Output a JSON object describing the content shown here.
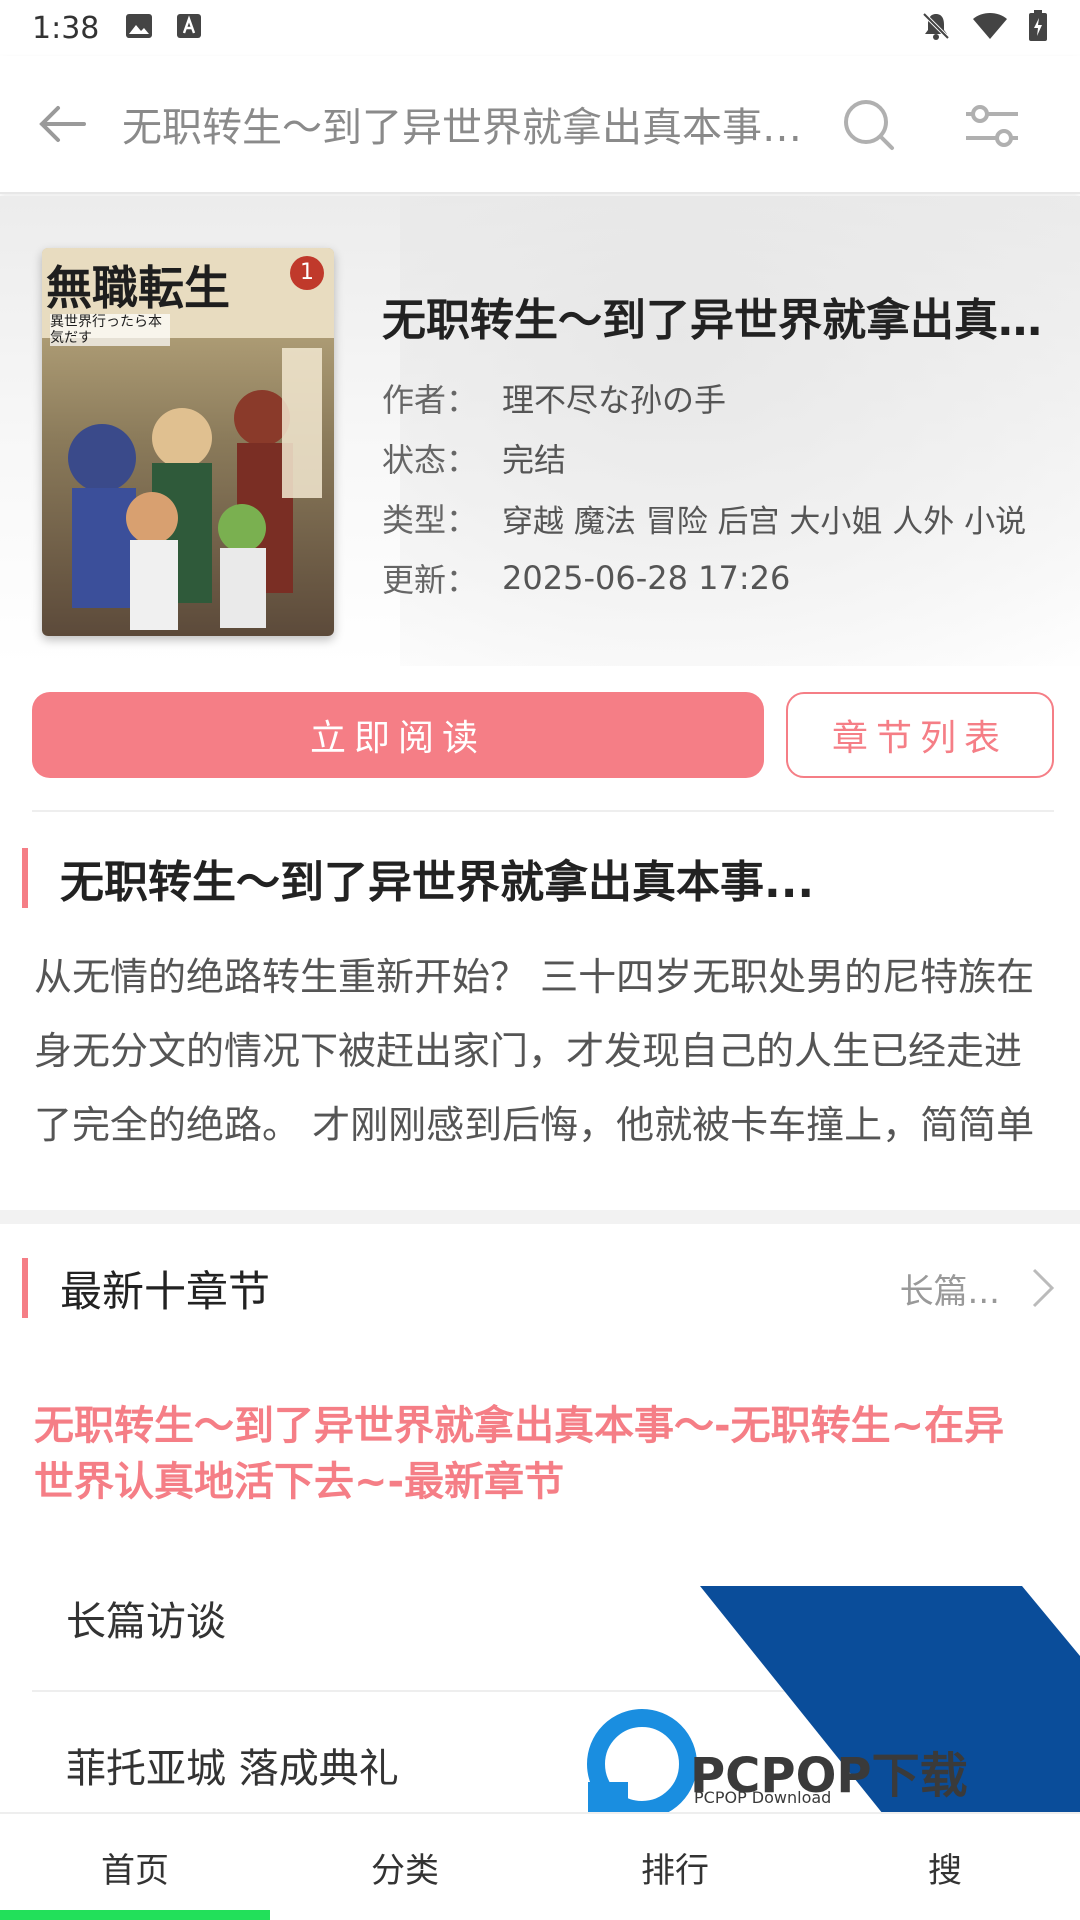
{
  "status_bar": {
    "time": "1:38",
    "icons_left": [
      "image-icon",
      "font-icon"
    ],
    "icons_right": [
      "bell-off-icon",
      "wifi-icon",
      "battery-charging-icon"
    ]
  },
  "toolbar": {
    "title": "无职转生～到了异世界就拿出真本事～-...",
    "icons": [
      "back-arrow-icon",
      "search-icon",
      "filter-sliders-icon"
    ]
  },
  "book": {
    "title": "无职转生～到了异世界就拿出真本...",
    "cover_text": "無職転生",
    "cover_volume": "1",
    "cover_subtitle": "異世界行ったら本気だす",
    "author_key": "作者：",
    "author": "理不尽な孙の手",
    "status_key": "状态：",
    "status": "完结",
    "genre_key": "类型：",
    "genre": "穿越 魔法 冒险 后宫 大小姐 人外 小说",
    "updated_key": "更新：",
    "updated": "2025-06-28 17:26"
  },
  "actions": {
    "read_now": "立即阅读",
    "chapter_list": "章节列表"
  },
  "intro": {
    "heading": "无职转生～到了异世界就拿出真本事...",
    "text": "从无情的绝路转生重新开始？ 三十四岁无职处男的尼特族在身无分文的情况下被赶出家门，才发现自己的人生已经走进了完全的绝路。 才刚刚感到后悔，他就被卡车撞上，简简单"
  },
  "latest": {
    "heading": "最新十章节",
    "more": "长篇...",
    "link_text": "无职转生～到了异世界就拿出真本事～-无职转生~在异世界认真地活下去~-最新章节",
    "chapters": [
      "长篇访谈",
      "菲托亚城 落成典礼"
    ]
  },
  "watermark": {
    "brand": "PCPOP下载",
    "sub": "PCPOP Download"
  },
  "bottom_nav": {
    "items": [
      "首页",
      "分类",
      "排行",
      "搜"
    ],
    "active_index": 0,
    "indicator_color": "#22e05a"
  },
  "colors": {
    "accent": "#f57e86",
    "watermark_blue": "#0a4d9a"
  }
}
